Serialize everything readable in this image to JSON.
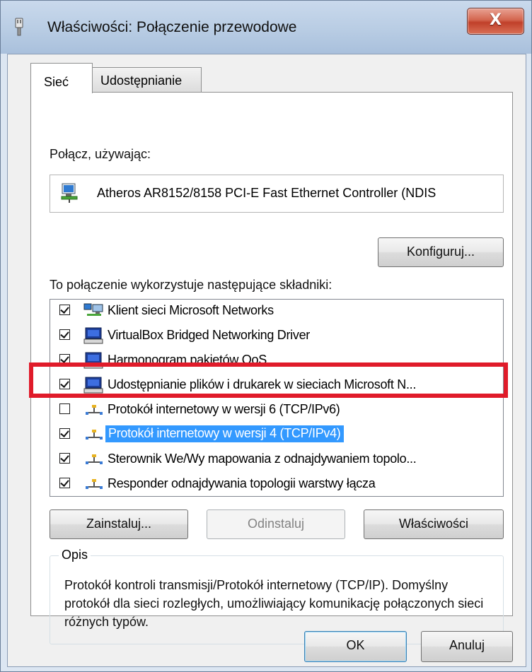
{
  "window": {
    "title": "Właściwości: Połączenie przewodowe",
    "close_glyph": "X"
  },
  "tabs": [
    {
      "label": "Sieć",
      "selected": true
    },
    {
      "label": "Udostępnianie",
      "selected": false
    }
  ],
  "connect_using": {
    "label": "Połącz, używając:",
    "adapter": "Atheros AR8152/8158 PCI-E Fast Ethernet Controller (NDIS"
  },
  "buttons": {
    "configure": "Konfiguruj...",
    "install": "Zainstaluj...",
    "uninstall": "Odinstaluj",
    "properties": "Właściwości",
    "ok": "OK",
    "cancel": "Anuluj"
  },
  "components": {
    "label": "To połączenie wykorzystuje następujące składniki:",
    "items": [
      {
        "label": "Klient sieci Microsoft Networks",
        "checked": true,
        "icon": "network-client-icon"
      },
      {
        "label": "VirtualBox Bridged Networking Driver",
        "checked": true,
        "icon": "network-service-icon"
      },
      {
        "label": "Harmonogram pakietów QoS",
        "checked": true,
        "icon": "network-service-icon"
      },
      {
        "label": "Udostępnianie plików i drukarek w sieciach Microsoft N...",
        "checked": true,
        "icon": "network-service-icon"
      },
      {
        "label": "Protokół internetowy w wersji 6 (TCP/IPv6)",
        "checked": false,
        "icon": "protocol-icon"
      },
      {
        "label": "Protokół internetowy w wersji 4 (TCP/IPv4)",
        "checked": true,
        "icon": "protocol-icon",
        "selected": true
      },
      {
        "label": "Sterownik We/Wy mapowania z odnajdywaniem topolo...",
        "checked": true,
        "icon": "protocol-icon"
      },
      {
        "label": "Responder odnajdywania topologii warstwy łącza",
        "checked": true,
        "icon": "protocol-icon"
      }
    ]
  },
  "description": {
    "legend": "Opis",
    "text": "Protokół kontroli transmisji/Protokół internetowy (TCP/IP). Domyślny protokół dla sieci rozległych, umożliwiający komunikację połączonych sieci różnych typów."
  },
  "colors": {
    "selection": "#3399ff",
    "highlight_box": "#e01b2a"
  }
}
